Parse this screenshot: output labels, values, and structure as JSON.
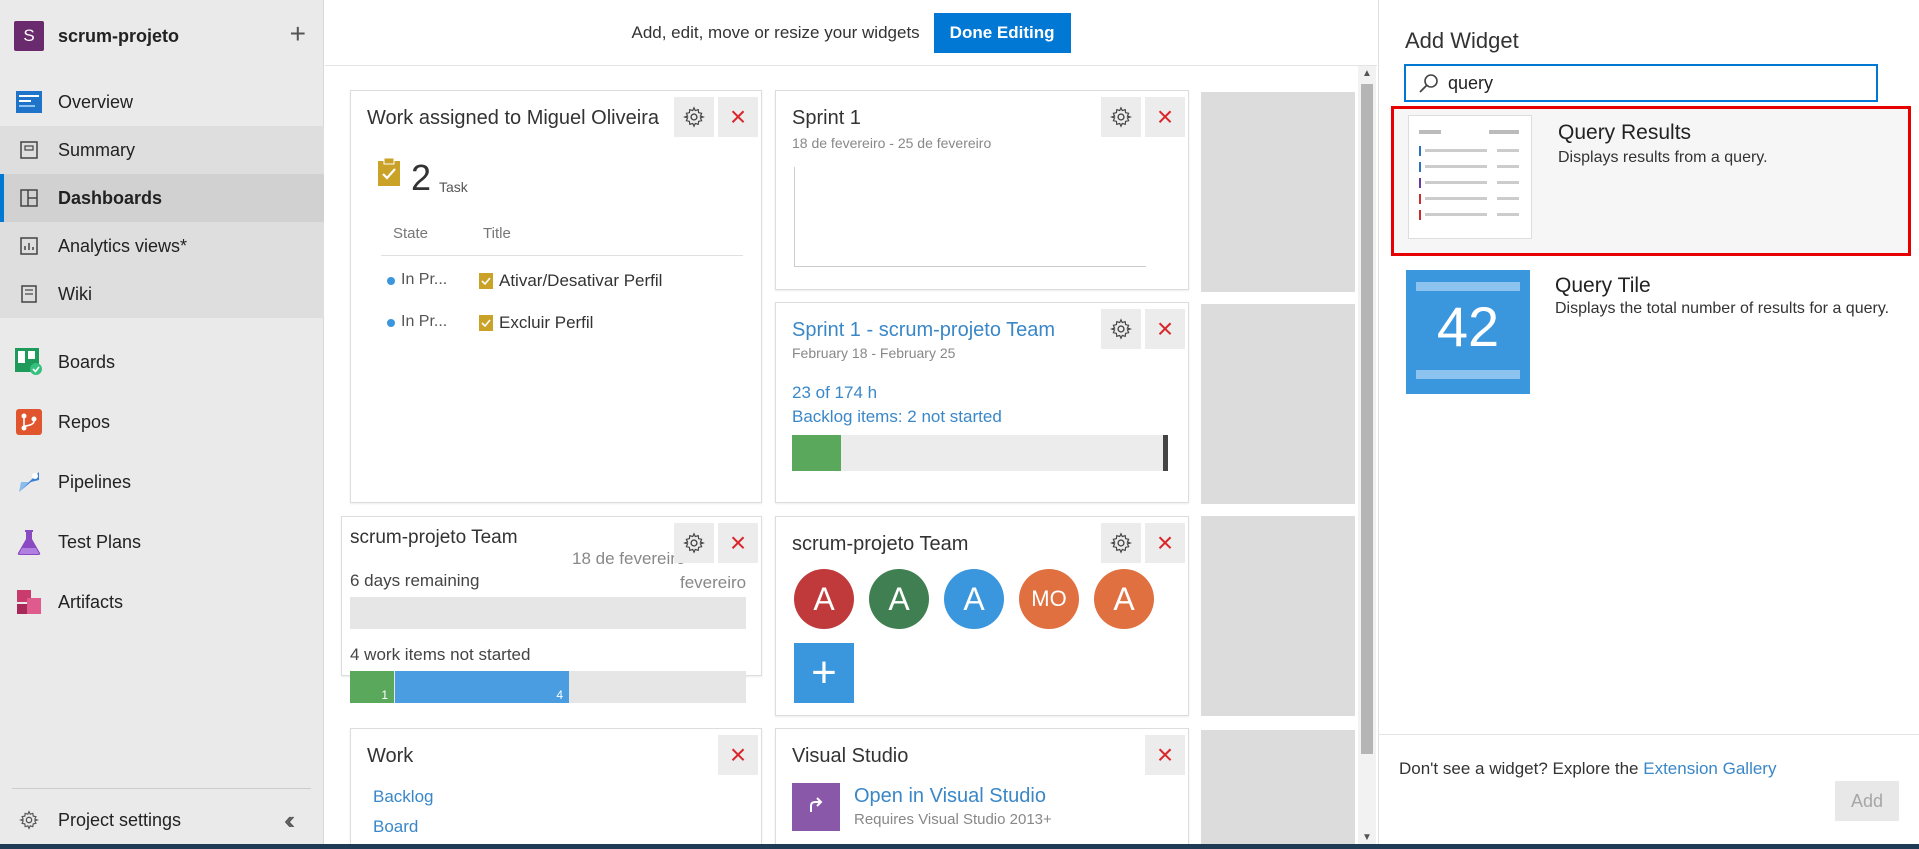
{
  "project": {
    "initial": "S",
    "name": "scrum-projeto"
  },
  "nav": {
    "overview": "Overview",
    "summary": "Summary",
    "dashboards": "Dashboards",
    "analytics": "Analytics views*",
    "wiki": "Wiki",
    "boards": "Boards",
    "repos": "Repos",
    "pipelines": "Pipelines",
    "testplans": "Test Plans",
    "artifacts": "Artifacts",
    "settings": "Project settings"
  },
  "editbar": {
    "text": "Add, edit, move or resize your widgets",
    "done": "Done Editing"
  },
  "widgets": {
    "assigned": {
      "title": "Work assigned to Miguel Oliveira",
      "count": "2",
      "count_label": "Task",
      "col_state": "State",
      "col_title": "Title",
      "rows": [
        {
          "state": "In Pr...",
          "title": "Ativar/Desativar Perfil"
        },
        {
          "state": "In Pr...",
          "title": "Excluir Perfil"
        }
      ]
    },
    "sprint1": {
      "title": "Sprint 1",
      "dates": "18 de fevereiro - 25 de fevereiro"
    },
    "sprintTeam": {
      "title": "Sprint 1 - scrum-projeto Team",
      "dates": "February 18 - February 25",
      "hours": "23 of 174 h",
      "backlog": "Backlog items: 2 not started",
      "progress": 0.13
    },
    "teamBurn": {
      "title": "scrum-projeto Team",
      "date_line1": "18 de fevereiro",
      "date_line2": "fevereiro",
      "remaining": "6 days remaining",
      "not_started": "4 work items not started",
      "bar_green": "1",
      "bar_blue": "4"
    },
    "teamMembers": {
      "title": "scrum-projeto Team",
      "members": [
        {
          "initials": "A",
          "color": "#c0393b"
        },
        {
          "initials": "A",
          "color": "#3f7f52"
        },
        {
          "initials": "A",
          "color": "#3a96dd"
        },
        {
          "initials": "MO",
          "color": "#e07040"
        },
        {
          "initials": "A",
          "color": "#e07040"
        }
      ]
    },
    "work": {
      "title": "Work",
      "link1": "Backlog",
      "link2": "Board"
    },
    "vs": {
      "title": "Visual Studio",
      "link": "Open in Visual Studio",
      "note": "Requires Visual Studio 2013+"
    }
  },
  "panel": {
    "title": "Add Widget",
    "search_value": "query",
    "options": [
      {
        "name": "Query Results",
        "desc": "Displays results from a query."
      },
      {
        "name": "Query Tile",
        "desc": "Displays the total number of results for a query.",
        "number": "42"
      }
    ],
    "footer_text": "Don't see a widget? Explore the ",
    "footer_link": "Extension Gallery",
    "add": "Add"
  },
  "colors": {
    "accent": "#0078d4",
    "selection": "#e60000",
    "close": "#d9262b"
  }
}
